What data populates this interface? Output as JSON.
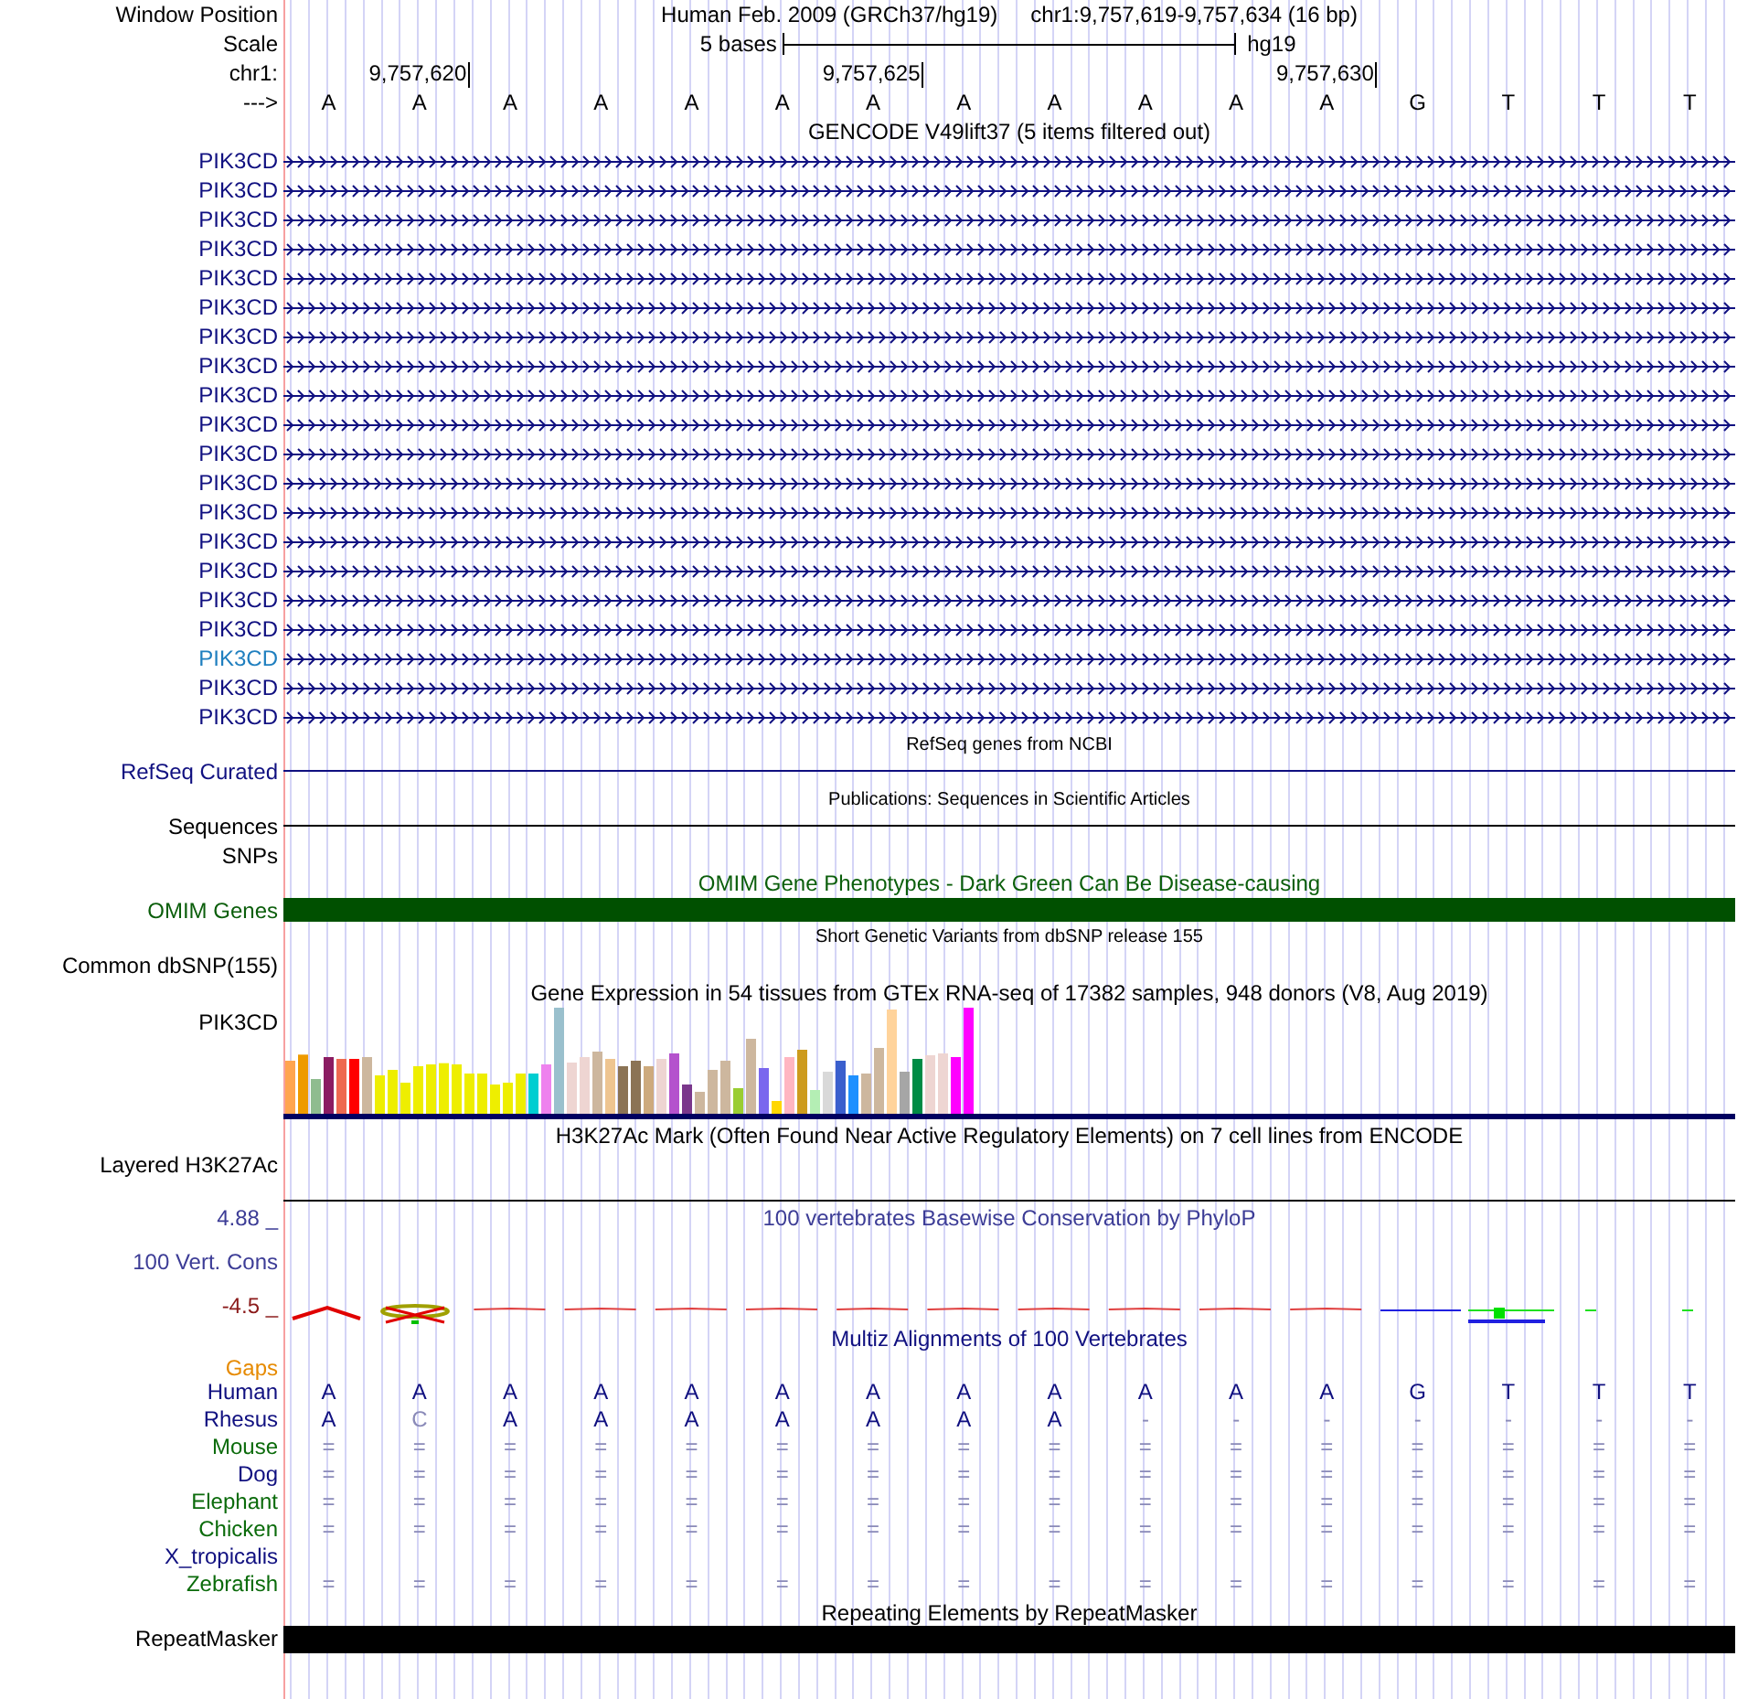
{
  "header": {
    "window_position": {
      "label": "Window Position",
      "assembly": "Human Feb. 2009 (GRCh37/hg19)",
      "range": "chr1:9,757,619-9,757,634 (16 bp)"
    },
    "scale": {
      "label": "Scale",
      "length": "5 bases",
      "assembly": "hg19"
    },
    "ruler": {
      "label": "chr1:",
      "ticks": [
        "9,757,620",
        "9,757,625",
        "9,757,630"
      ]
    },
    "bases": {
      "label": "--->",
      "letters": [
        "A",
        "A",
        "A",
        "A",
        "A",
        "A",
        "A",
        "A",
        "A",
        "A",
        "A",
        "A",
        "G",
        "T",
        "T",
        "T"
      ]
    }
  },
  "tracks": [
    {
      "kind": "gene_rows",
      "title": "GENCODE V49lift37 (5 items filtered out)",
      "color": "#101080",
      "rows": [
        {
          "label": "PIK3CD",
          "highlighted": false
        },
        {
          "label": "PIK3CD",
          "highlighted": false
        },
        {
          "label": "PIK3CD",
          "highlighted": false
        },
        {
          "label": "PIK3CD",
          "highlighted": false
        },
        {
          "label": "PIK3CD",
          "highlighted": false
        },
        {
          "label": "PIK3CD",
          "highlighted": false
        },
        {
          "label": "PIK3CD",
          "highlighted": false
        },
        {
          "label": "PIK3CD",
          "highlighted": false
        },
        {
          "label": "PIK3CD",
          "highlighted": false
        },
        {
          "label": "PIK3CD",
          "highlighted": false
        },
        {
          "label": "PIK3CD",
          "highlighted": false
        },
        {
          "label": "PIK3CD",
          "highlighted": false
        },
        {
          "label": "PIK3CD",
          "highlighted": false
        },
        {
          "label": "PIK3CD",
          "highlighted": false
        },
        {
          "label": "PIK3CD",
          "highlighted": false
        },
        {
          "label": "PIK3CD",
          "highlighted": false
        },
        {
          "label": "PIK3CD",
          "highlighted": false
        },
        {
          "label": "PIK3CD",
          "highlighted": true
        },
        {
          "label": "PIK3CD",
          "highlighted": false
        },
        {
          "label": "PIK3CD",
          "highlighted": false
        }
      ]
    },
    {
      "kind": "line",
      "title": "RefSeq genes from NCBI",
      "label": "RefSeq Curated",
      "color": "#101080"
    },
    {
      "kind": "line",
      "title": "Publications: Sequences in Scientific Articles",
      "label": "Sequences",
      "color": "#000000"
    },
    {
      "kind": "empty",
      "label": "SNPs",
      "color": "#000000"
    },
    {
      "kind": "bar",
      "title": "OMIM Gene Phenotypes - Dark Green Can Be Disease-causing",
      "label": "OMIM Genes",
      "color": "#0b5e0b"
    },
    {
      "kind": "empty",
      "title": "Short Genetic Variants from dbSNP release 155",
      "label": "Common dbSNP(155)",
      "color": "#000000"
    },
    {
      "kind": "expression",
      "title": "Gene Expression in 54 tissues from GTEx RNA-seq of 17382 samples, 948 donors (V8, Aug 2019)",
      "label": "PIK3CD",
      "color": "#000000"
    },
    {
      "kind": "tall_line",
      "title": "H3K27Ac Mark (Often Found Near Active Regulatory Elements) on 7 cell lines from ENCODE",
      "label": "Layered H3K27Ac",
      "color": "#000000"
    },
    {
      "kind": "wiggle",
      "title": "100 vertebrates Basewise Conservation by PhyloP",
      "label": "100 Vert. Cons",
      "max": "4.88 _",
      "min": "-4.5 _",
      "color": "#3c3c96"
    },
    {
      "kind": "alignment",
      "title": "Multiz Alignments of 100 Vertebrates",
      "gap_label": "Gaps",
      "color": "#101080",
      "species": [
        {
          "name": "Human",
          "color": "#101080",
          "letters": [
            "A",
            "A",
            "A",
            "A",
            "A",
            "A",
            "A",
            "A",
            "A",
            "A",
            "A",
            "A",
            "G",
            "T",
            "T",
            "T"
          ]
        },
        {
          "name": "Rhesus",
          "color": "#101080",
          "letters": [
            "A",
            "C",
            "A",
            "A",
            "A",
            "A",
            "A",
            "A",
            "A",
            "-",
            "-",
            "-",
            "-",
            "-",
            "-",
            "-"
          ]
        },
        {
          "name": "Mouse",
          "color": "#0b6b0b",
          "letters": [
            "=",
            "=",
            "=",
            "=",
            "=",
            "=",
            "=",
            "=",
            "=",
            "=",
            "=",
            "=",
            "=",
            "=",
            "=",
            "="
          ]
        },
        {
          "name": "Dog",
          "color": "#101080",
          "letters": [
            "=",
            "=",
            "=",
            "=",
            "=",
            "=",
            "=",
            "=",
            "=",
            "=",
            "=",
            "=",
            "=",
            "=",
            "=",
            "="
          ]
        },
        {
          "name": "Elephant",
          "color": "#0b6b0b",
          "letters": [
            "=",
            "=",
            "=",
            "=",
            "=",
            "=",
            "=",
            "=",
            "=",
            "=",
            "=",
            "=",
            "=",
            "=",
            "=",
            "="
          ]
        },
        {
          "name": "Chicken",
          "color": "#0b6b0b",
          "letters": [
            "=",
            "=",
            "=",
            "=",
            "=",
            "=",
            "=",
            "=",
            "=",
            "=",
            "=",
            "=",
            "=",
            "=",
            "=",
            "="
          ]
        },
        {
          "name": "X_tropicalis",
          "color": "#101080"
        },
        {
          "name": "Zebrafish",
          "color": "#0b6b0b",
          "letters": [
            "=",
            "=",
            "=",
            "=",
            "=",
            "=",
            "=",
            "=",
            "=",
            "=",
            "=",
            "=",
            "=",
            "=",
            "=",
            "="
          ]
        }
      ]
    },
    {
      "kind": "solid",
      "title": "Repeating Elements by RepeatMasker",
      "label": "RepeatMasker",
      "color": "#000000"
    }
  ]
}
